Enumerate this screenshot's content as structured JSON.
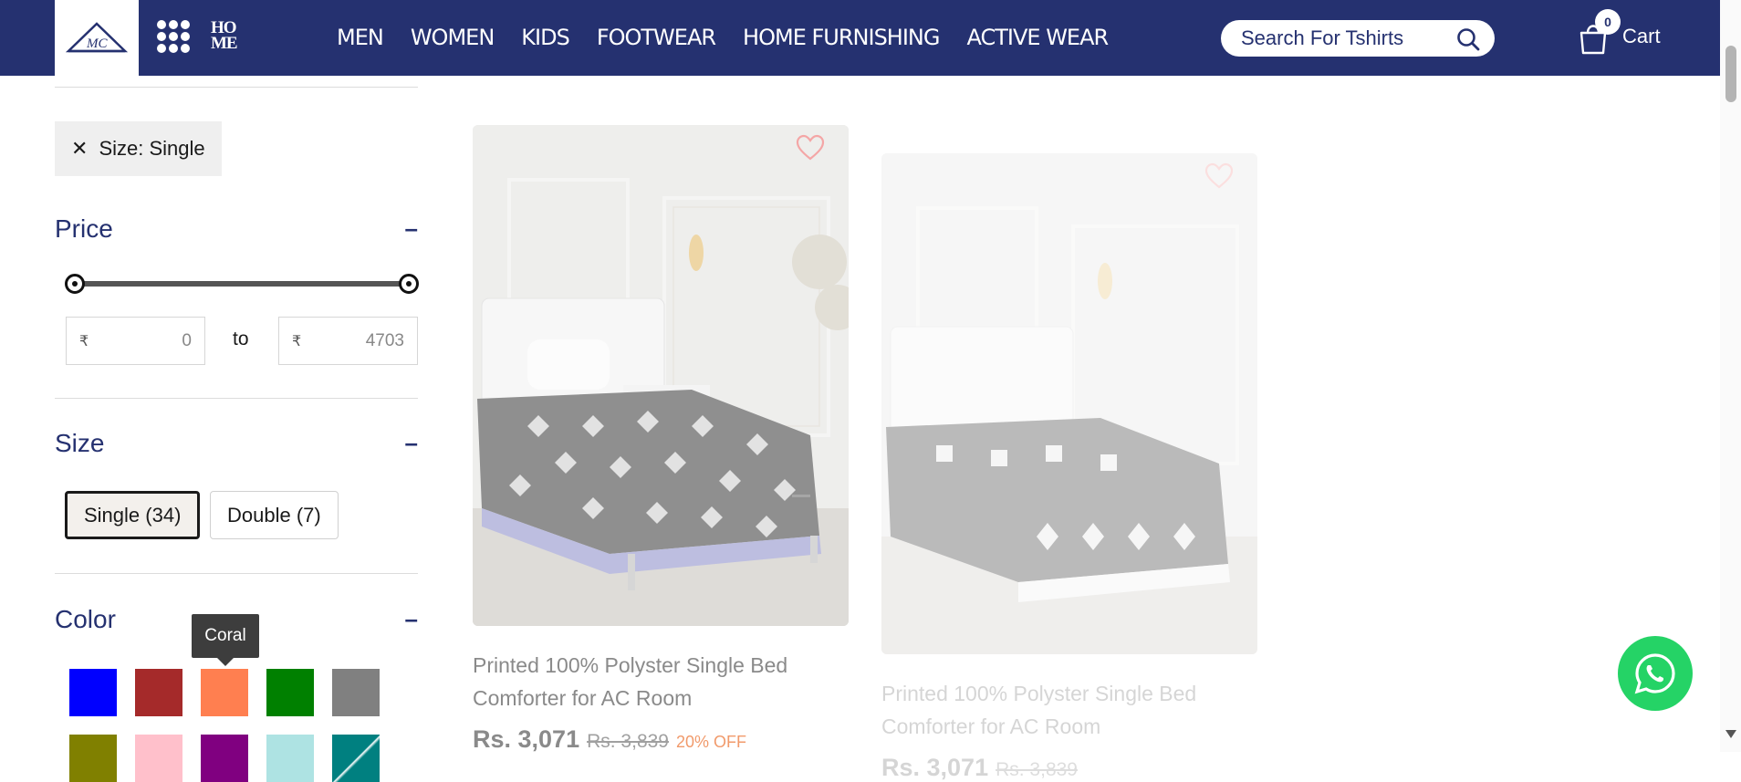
{
  "header": {
    "logo_text": "MC",
    "home_logo_line1": "HO",
    "home_logo_line2": "ME",
    "nav": [
      "MEN",
      "WOMEN",
      "KIDS",
      "FOOTWEAR",
      "HOME FURNISHING",
      "ACTIVE WEAR"
    ],
    "search_placeholder": "Search For Tshirts",
    "cart_count": "0",
    "cart_label": "Cart",
    "bg_color": "#253170"
  },
  "filters": {
    "active_chip": "Size: Single",
    "price": {
      "title": "Price",
      "collapse": "–",
      "currency": "₹",
      "min": "0",
      "max": "4703",
      "to_label": "to"
    },
    "size": {
      "title": "Size",
      "collapse": "–",
      "options": [
        {
          "label": "Single (34)",
          "selected": true
        },
        {
          "label": "Double (7)",
          "selected": false
        }
      ]
    },
    "color": {
      "title": "Color",
      "collapse": "–",
      "tooltip": "Coral",
      "swatches": [
        "#0000ff",
        "#a52a2a",
        "#ff7f50",
        "#008000",
        "#808080",
        "#808000",
        "#ffc0cb",
        "#800080",
        "#aee3e3",
        "#008080"
      ]
    }
  },
  "products": [
    {
      "title": "Printed 100% Polyster Single Bed Comforter for AC Room",
      "price": "Rs. 3,071",
      "mrp": "Rs. 3,839",
      "discount": "20% OFF"
    },
    {
      "title": "Printed 100% Polyster Single Bed Comforter for AC Room",
      "price": "Rs. 3,071",
      "mrp": "Rs. 3,839",
      "discount": ""
    }
  ]
}
